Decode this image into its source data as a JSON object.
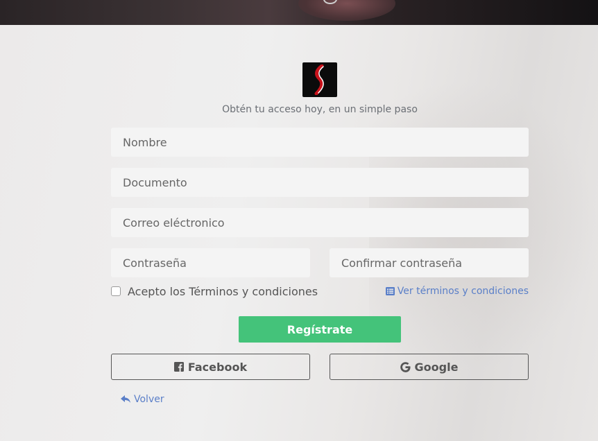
{
  "subtitle": "Obtén tu acceso hoy, en un simple paso",
  "form": {
    "name_placeholder": "Nombre",
    "document_placeholder": "Documento",
    "email_placeholder": "Correo eléctronico",
    "password_placeholder": "Contraseña",
    "confirm_password_placeholder": "Confirmar contraseña",
    "terms_checkbox_label": "Acepto los Términos y condiciones",
    "terms_link": "Ver términos y condiciones",
    "submit_label": "Regístrate"
  },
  "social": {
    "facebook_label": "Facebook",
    "google_label": "Google"
  },
  "back_label": "Volver",
  "colors": {
    "primary_button": "#44c37a",
    "link": "#5a7fc8"
  }
}
